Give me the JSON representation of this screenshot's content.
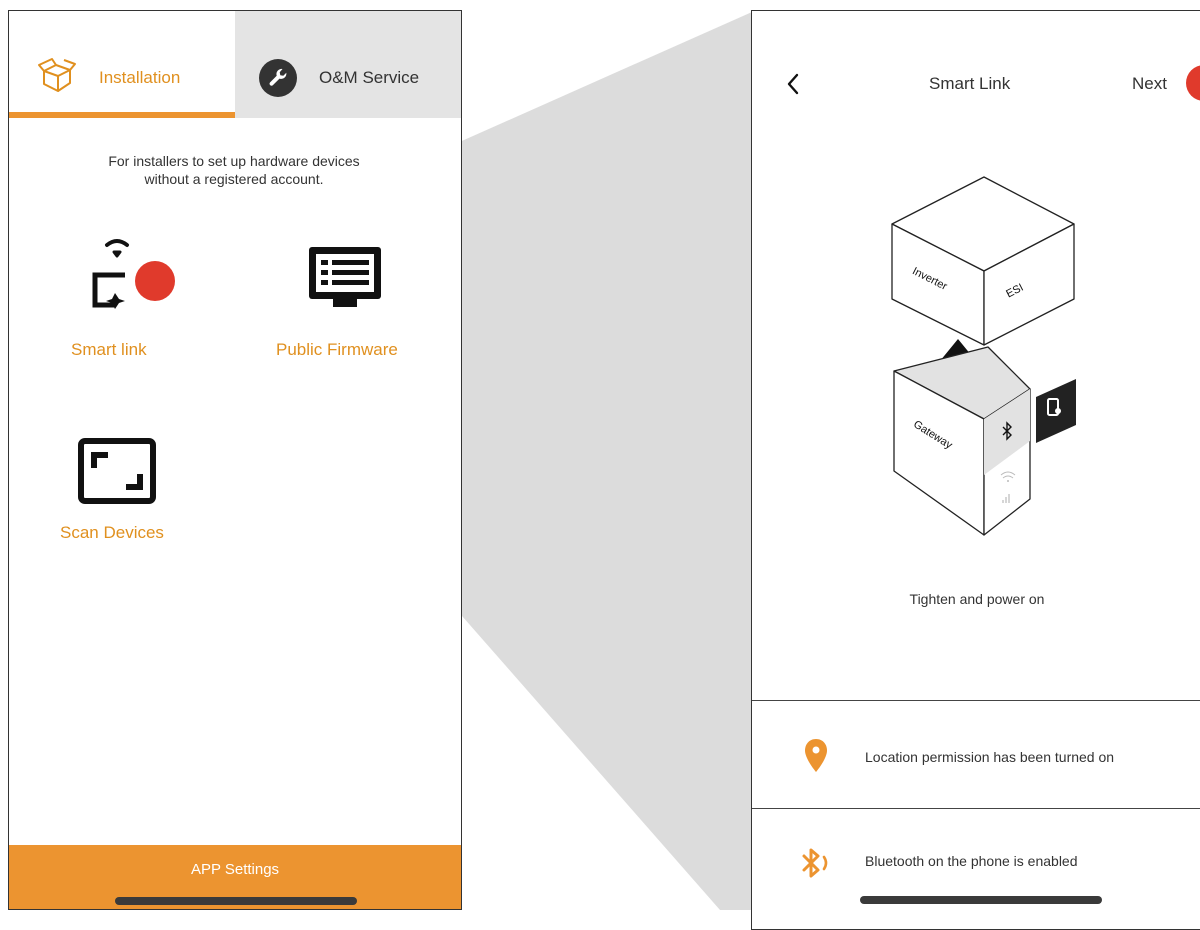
{
  "left_screen": {
    "tabs": [
      {
        "label": "Installation",
        "icon": "box-icon"
      },
      {
        "label": "O&M Service",
        "icon": "wrench-icon"
      }
    ],
    "description_line1": "For installers to set up hardware devices",
    "description_line2": "without a registered account.",
    "features": {
      "smart_link": "Smart link",
      "public_firmware": "Public Firmware",
      "scan_devices": "Scan Devices"
    },
    "footer_button": "APP Settings"
  },
  "right_screen": {
    "header": {
      "back": "back-icon",
      "title": "Smart Link",
      "next": "Next"
    },
    "illustration": {
      "top_box_labels": [
        "Inverter",
        "ESI"
      ],
      "bottom_box_label": "Gateway"
    },
    "caption": "Tighten and power on",
    "permissions": [
      {
        "icon": "location-pin-icon",
        "text": "Location permission has been turned on"
      },
      {
        "icon": "bluetooth-icon",
        "text": "Bluetooth on the phone is enabled"
      }
    ]
  },
  "colors": {
    "accent": "#ec9430",
    "accent_text": "#e0901f",
    "highlight_dot": "#e03a2c",
    "tab_inactive_bg": "#e4e4e4",
    "zoom_wedge": "#dcdcdc"
  }
}
